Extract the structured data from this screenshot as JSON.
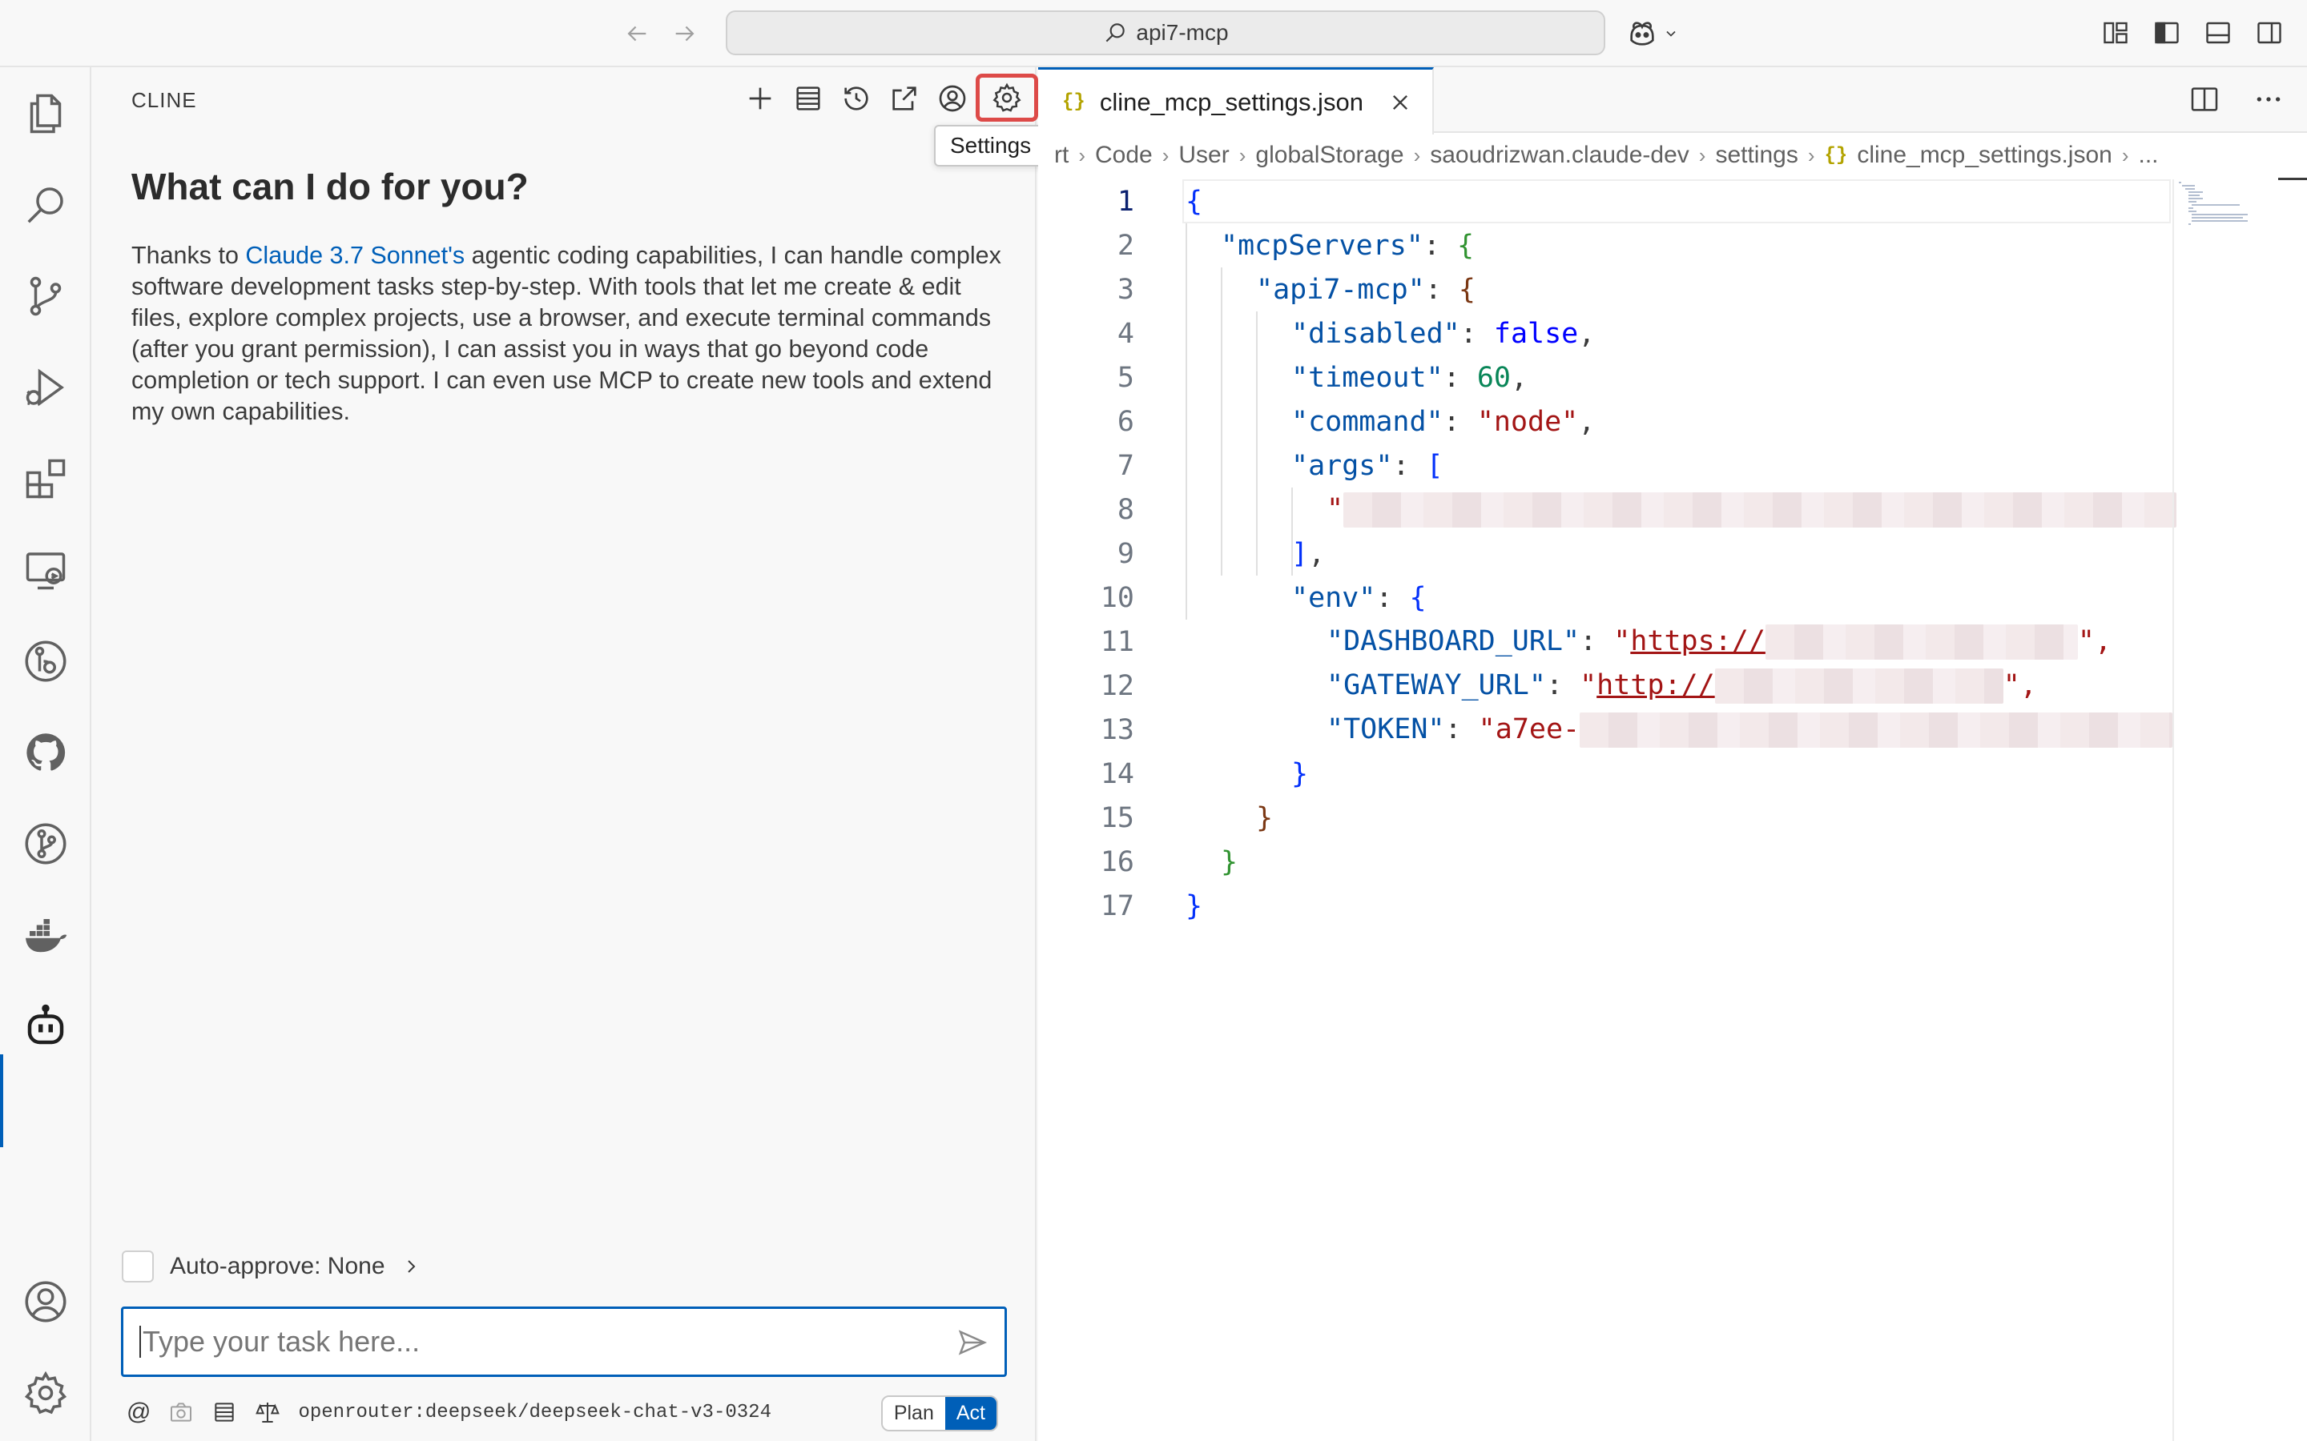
{
  "titlebar": {
    "search_text": "api7-mcp"
  },
  "cline": {
    "title": "CLINE",
    "tooltip": "Settings",
    "heading": "What can I do for you?",
    "intro_prefix": "Thanks to ",
    "intro_link": "Claude 3.7 Sonnet's",
    "intro_rest": " agentic coding capabilities, I can handle complex software development tasks step-by-step. With tools that let me create & edit files, explore complex projects, use a browser, and execute terminal commands (after you grant permission), I can assist you in ways that go beyond code completion or tech support. I can even use MCP to create new tools and extend my own capabilities.",
    "auto_approve": "Auto-approve: None",
    "input_placeholder": "Type your task here...",
    "at_symbol": "@",
    "model": "openrouter:deepseek/deepseek-chat-v3-0324",
    "mode_plan": "Plan",
    "mode_act": "Act"
  },
  "editor": {
    "tab_badge": "{}",
    "tab_label": "cline_mcp_settings.json",
    "breadcrumb": [
      "rt",
      "Code",
      "User",
      "globalStorage",
      "saoudrizwan.claude-dev",
      "settings",
      "cline_mcp_settings.json",
      "..."
    ],
    "line_numbers": [
      "1",
      "2",
      "3",
      "4",
      "5",
      "6",
      "7",
      "8",
      "9",
      "10",
      "11",
      "12",
      "13",
      "14",
      "15",
      "16",
      "17"
    ],
    "code": {
      "l1_open": "{",
      "l2_key": "\"mcpServers\"",
      "l2_rest": ": ",
      "l2_brace": "{",
      "l3_key": "\"api7-mcp\"",
      "l3_rest": ": ",
      "l3_brace": "{",
      "l4_key": "\"disabled\"",
      "l4_sep": ": ",
      "l4_val": "false",
      "l4_end": ",",
      "l5_key": "\"timeout\"",
      "l5_sep": ": ",
      "l5_val": "60",
      "l5_end": ",",
      "l6_key": "\"command\"",
      "l6_sep": ": ",
      "l6_val": "\"node\"",
      "l6_end": ",",
      "l7_key": "\"args\"",
      "l7_sep": ": ",
      "l7_val": "[",
      "l8_val": "\"",
      "l9_val": "]",
      "l9_end": ",",
      "l10_key": "\"env\"",
      "l10_sep": ": ",
      "l10_val": "{",
      "l11_key": "\"DASHBOARD_URL\"",
      "l11_sep": ": ",
      "l11_q": "\"",
      "l11_val": "https://",
      "l11_end": "\",",
      "l12_key": "\"GATEWAY_URL\"",
      "l12_sep": ": ",
      "l12_q": "\"",
      "l12_val": "http://",
      "l12_end": "\",",
      "l13_key": "\"TOKEN\"",
      "l13_sep": ": ",
      "l13_val": "\"a7ee-",
      "l14_val": "}",
      "l15_val": "}",
      "l16_val": "}",
      "l17_val": "}"
    }
  },
  "colors": {
    "accent": "#005fb8",
    "highlight_red": "#dd4a48"
  },
  "icons": {
    "activity_bar": [
      "explorer-icon",
      "search-icon",
      "source-control-icon",
      "run-debug-icon",
      "extensions-icon",
      "remote-explorer-icon",
      "gitlens-icon",
      "github-icon",
      "git-graph-icon",
      "docker-icon",
      "cline-icon",
      "account-icon",
      "manage-gear-icon"
    ]
  }
}
